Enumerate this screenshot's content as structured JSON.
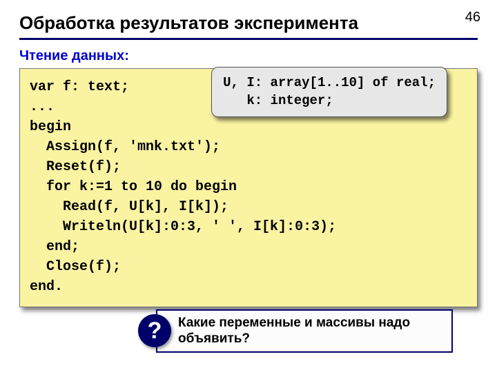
{
  "page_number": "46",
  "title": "Обработка результатов эксперимента",
  "subtitle": "Чтение данных:",
  "code": "var f: text;\n...\nbegin\n  Assign(f, 'mnk.txt');\n  Reset(f);\n  for k:=1 to 10 do begin\n    Read(f, U[k], I[k]);\n    Writeln(U[k]:0:3, ' ', I[k]:0:3);\n  end;\n  Close(f);\nend.",
  "annotation": "U, I: array[1..10] of real;\n   k: integer;",
  "question_mark": "?",
  "question_text": "Какие переменные и массивы надо объявить?"
}
